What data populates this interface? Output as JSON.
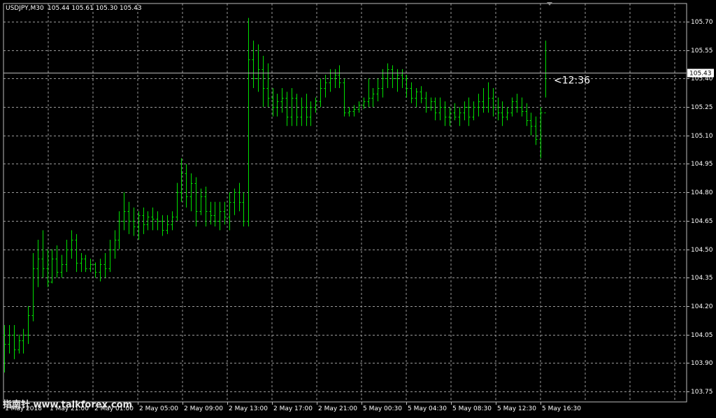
{
  "header": {
    "symbol_label": "USDJPY,M30",
    "ohlc_label": "105.44 105.61 105.30 105.43"
  },
  "price_axis": {
    "ticks": [
      "105.70",
      "105.55",
      "105.40",
      "105.25",
      "105.10",
      "104.95",
      "104.80",
      "104.65",
      "104.50",
      "104.35",
      "104.20",
      "104.05",
      "103.90",
      "103.75"
    ],
    "current_price_label": "105.43"
  },
  "time_axis": {
    "labels": [
      "1 May 2018",
      "1 May 21:00",
      "2 May 01:00",
      "2 May 05:00",
      "2 May 09:00",
      "2 May 13:00",
      "2 May 17:00",
      "2 May 21:00",
      "5 May 00:30",
      "5 May 04:30",
      "5 May 08:30",
      "5 May 12:30",
      "5 May 16:30"
    ]
  },
  "countdown_label": "<12:36",
  "watermark_text": "指南针 www.talkforex.com",
  "colors": {
    "background": "#000000",
    "grid": "#9a9a9a",
    "bars": "#00e000",
    "text": "#ffffff",
    "bid_line": "#b8b8b8",
    "price_tag_bg": "#ffffff",
    "price_tag_text": "#000000"
  },
  "chart_data": {
    "type": "ohlc",
    "title": "USDJPY,M30",
    "y_range": [
      103.7,
      105.75
    ],
    "last_price": 105.43,
    "grid": true,
    "series": [
      {
        "values": [
          [
            104.05,
            104.1,
            103.85,
            104.0
          ],
          [
            104.0,
            104.1,
            103.95,
            104.05
          ],
          [
            104.05,
            104.1,
            103.92,
            103.97
          ],
          [
            103.97,
            104.05,
            103.95,
            104.02
          ],
          [
            104.02,
            104.08,
            103.95,
            104.05
          ],
          [
            104.05,
            104.2,
            104.0,
            104.15
          ],
          [
            104.15,
            104.48,
            104.12,
            104.4
          ],
          [
            104.4,
            104.55,
            104.3,
            104.45
          ],
          [
            104.45,
            104.6,
            104.35,
            104.4
          ],
          [
            104.4,
            104.5,
            104.3,
            104.33
          ],
          [
            104.33,
            104.5,
            104.32,
            104.45
          ],
          [
            104.45,
            104.52,
            104.35,
            104.38
          ],
          [
            104.38,
            104.47,
            104.35,
            104.42
          ],
          [
            104.42,
            104.55,
            104.38,
            104.5
          ],
          [
            104.5,
            104.6,
            104.45,
            104.55
          ],
          [
            104.55,
            104.58,
            104.38,
            104.43
          ],
          [
            104.43,
            104.48,
            104.38,
            104.45
          ],
          [
            104.45,
            104.47,
            104.38,
            104.4
          ],
          [
            104.4,
            104.45,
            104.38,
            104.42
          ],
          [
            104.42,
            104.43,
            104.35,
            104.38
          ],
          [
            104.38,
            104.45,
            104.33,
            104.42
          ],
          [
            104.42,
            104.48,
            104.35,
            104.4
          ],
          [
            104.4,
            104.55,
            104.38,
            104.5
          ],
          [
            104.5,
            104.6,
            104.45,
            104.55
          ],
          [
            104.55,
            104.7,
            104.5,
            104.65
          ],
          [
            104.65,
            104.8,
            104.6,
            104.7
          ],
          [
            104.7,
            104.75,
            104.58,
            104.65
          ],
          [
            104.65,
            104.72,
            104.57,
            104.62
          ],
          [
            104.62,
            104.7,
            104.55,
            104.68
          ],
          [
            104.68,
            104.72,
            104.58,
            104.63
          ],
          [
            104.63,
            104.7,
            104.6,
            104.67
          ],
          [
            104.67,
            104.72,
            104.6,
            104.66
          ],
          [
            104.66,
            104.7,
            104.6,
            104.65
          ],
          [
            104.65,
            104.68,
            104.57,
            104.6
          ],
          [
            104.6,
            104.68,
            104.58,
            104.63
          ],
          [
            104.63,
            104.7,
            104.6,
            104.67
          ],
          [
            104.67,
            104.85,
            104.65,
            104.8
          ],
          [
            104.8,
            104.98,
            104.75,
            104.9
          ],
          [
            104.9,
            104.95,
            104.72,
            104.78
          ],
          [
            104.78,
            104.9,
            104.7,
            104.85
          ],
          [
            104.85,
            104.88,
            104.62,
            104.7
          ],
          [
            104.7,
            104.82,
            104.68,
            104.78
          ],
          [
            104.78,
            104.83,
            104.62,
            104.7
          ],
          [
            104.7,
            104.75,
            104.63,
            104.68
          ],
          [
            104.68,
            104.75,
            104.62,
            104.65
          ],
          [
            104.65,
            104.75,
            104.6,
            104.7
          ],
          [
            104.7,
            104.75,
            104.63,
            104.67
          ],
          [
            104.67,
            104.8,
            104.6,
            104.75
          ],
          [
            104.75,
            104.82,
            104.68,
            104.8
          ],
          [
            104.8,
            104.85,
            104.7,
            104.75
          ],
          [
            104.75,
            104.8,
            104.62,
            104.65
          ],
          [
            104.65,
            105.72,
            104.62,
            105.5
          ],
          [
            105.5,
            105.6,
            105.35,
            105.4
          ],
          [
            105.4,
            105.58,
            105.33,
            105.45
          ],
          [
            105.45,
            105.52,
            105.25,
            105.35
          ],
          [
            105.35,
            105.48,
            105.25,
            105.3
          ],
          [
            105.3,
            105.35,
            105.2,
            105.25
          ],
          [
            105.25,
            105.32,
            105.2,
            105.28
          ],
          [
            105.28,
            105.35,
            105.22,
            105.3
          ],
          [
            105.3,
            105.33,
            105.15,
            105.2
          ],
          [
            105.2,
            105.35,
            105.15,
            105.3
          ],
          [
            105.3,
            105.32,
            105.15,
            105.2
          ],
          [
            105.2,
            105.3,
            105.15,
            105.25
          ],
          [
            105.25,
            105.32,
            105.15,
            105.2
          ],
          [
            105.2,
            105.28,
            105.15,
            105.25
          ],
          [
            105.25,
            105.3,
            105.22,
            105.28
          ],
          [
            105.28,
            105.4,
            105.25,
            105.35
          ],
          [
            105.35,
            105.42,
            105.3,
            105.38
          ],
          [
            105.38,
            105.45,
            105.33,
            105.4
          ],
          [
            105.4,
            105.45,
            105.35,
            105.42
          ],
          [
            105.42,
            105.47,
            105.35,
            105.38
          ],
          [
            105.38,
            105.4,
            105.2,
            105.22
          ],
          [
            105.22,
            105.25,
            105.2,
            105.23
          ],
          [
            105.23,
            105.26,
            105.2,
            105.24
          ],
          [
            105.24,
            105.28,
            105.22,
            105.26
          ],
          [
            105.26,
            105.3,
            105.24,
            105.28
          ],
          [
            105.28,
            105.4,
            105.25,
            105.3
          ],
          [
            105.3,
            105.35,
            105.25,
            105.32
          ],
          [
            105.32,
            105.4,
            105.28,
            105.35
          ],
          [
            105.35,
            105.45,
            105.3,
            105.4
          ],
          [
            105.4,
            105.48,
            105.35,
            105.45
          ],
          [
            105.45,
            105.47,
            105.35,
            105.4
          ],
          [
            105.4,
            105.45,
            105.33,
            105.42
          ],
          [
            105.42,
            105.45,
            105.35,
            105.4
          ],
          [
            105.4,
            105.42,
            105.3,
            105.35
          ],
          [
            105.35,
            105.38,
            105.27,
            105.3
          ],
          [
            105.3,
            105.35,
            105.25,
            105.33
          ],
          [
            105.33,
            105.36,
            105.27,
            105.3
          ],
          [
            105.3,
            105.33,
            105.22,
            105.25
          ],
          [
            105.25,
            105.3,
            105.23,
            105.28
          ],
          [
            105.28,
            105.3,
            105.18,
            105.22
          ],
          [
            105.22,
            105.3,
            105.18,
            105.25
          ],
          [
            105.25,
            105.28,
            105.15,
            105.2
          ],
          [
            105.2,
            105.25,
            105.15,
            105.22
          ],
          [
            105.22,
            105.27,
            105.18,
            105.2
          ],
          [
            105.2,
            105.25,
            105.15,
            105.22
          ],
          [
            105.22,
            105.28,
            105.18,
            105.25
          ],
          [
            105.25,
            105.3,
            105.15,
            105.2
          ],
          [
            105.2,
            105.28,
            105.18,
            105.25
          ],
          [
            105.25,
            105.32,
            105.2,
            105.28
          ],
          [
            105.28,
            105.35,
            105.22,
            105.25
          ],
          [
            105.25,
            105.38,
            105.22,
            105.3
          ],
          [
            105.3,
            105.35,
            105.2,
            105.25
          ],
          [
            105.25,
            105.3,
            105.18,
            105.22
          ],
          [
            105.22,
            105.28,
            105.15,
            105.2
          ],
          [
            105.2,
            105.25,
            105.18,
            105.22
          ],
          [
            105.22,
            105.3,
            105.2,
            105.28
          ],
          [
            105.28,
            105.32,
            105.22,
            105.25
          ],
          [
            105.25,
            105.3,
            105.2,
            105.23
          ],
          [
            105.23,
            105.27,
            105.15,
            105.18
          ],
          [
            105.18,
            105.22,
            105.1,
            105.15
          ],
          [
            105.15,
            105.2,
            105.05,
            105.08
          ],
          [
            105.08,
            105.25,
            104.98,
            105.22
          ],
          [
            105.22,
            105.6,
            105.3,
            105.43
          ]
        ]
      }
    ]
  }
}
